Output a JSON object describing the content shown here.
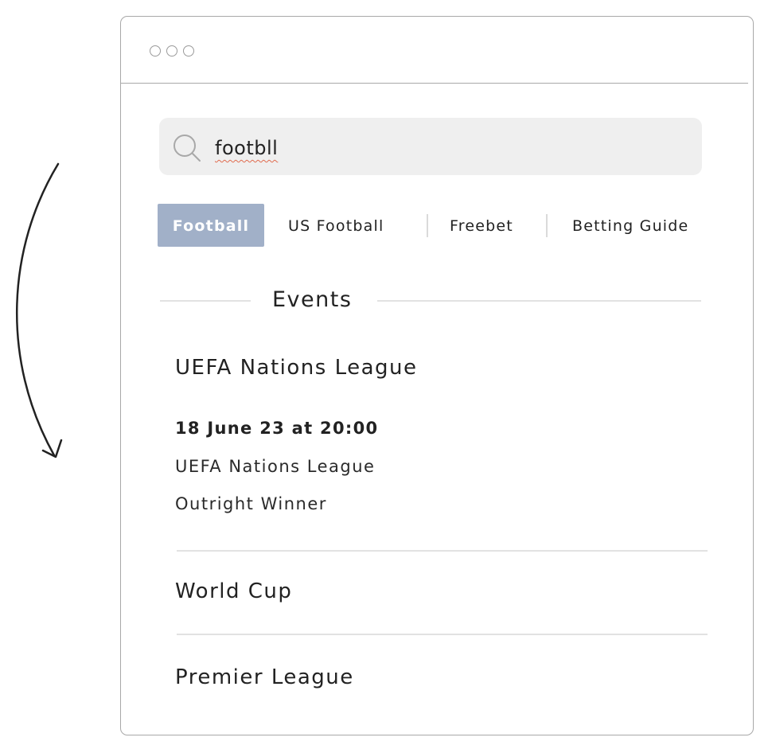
{
  "search": {
    "value": "footbll",
    "icon": "search-icon"
  },
  "tabs": [
    {
      "label": "Football",
      "active": true
    },
    {
      "label": "US Football",
      "active": false
    },
    {
      "label": "Freebet",
      "active": false
    },
    {
      "label": "Betting Guide",
      "active": false
    }
  ],
  "section": {
    "title": "Events"
  },
  "events": [
    {
      "name": "UEFA Nations League",
      "date": "18 June 23 at 20:00",
      "competition": "UEFA Nations League",
      "market": "Outright Winner"
    },
    {
      "name": "World Cup"
    },
    {
      "name": "Premier League"
    }
  ],
  "colors": {
    "active_tab": "#a1b0c8",
    "search_bg": "#efefef",
    "spellcheck_underline": "#e06b4f",
    "border": "#a8a8a8"
  }
}
